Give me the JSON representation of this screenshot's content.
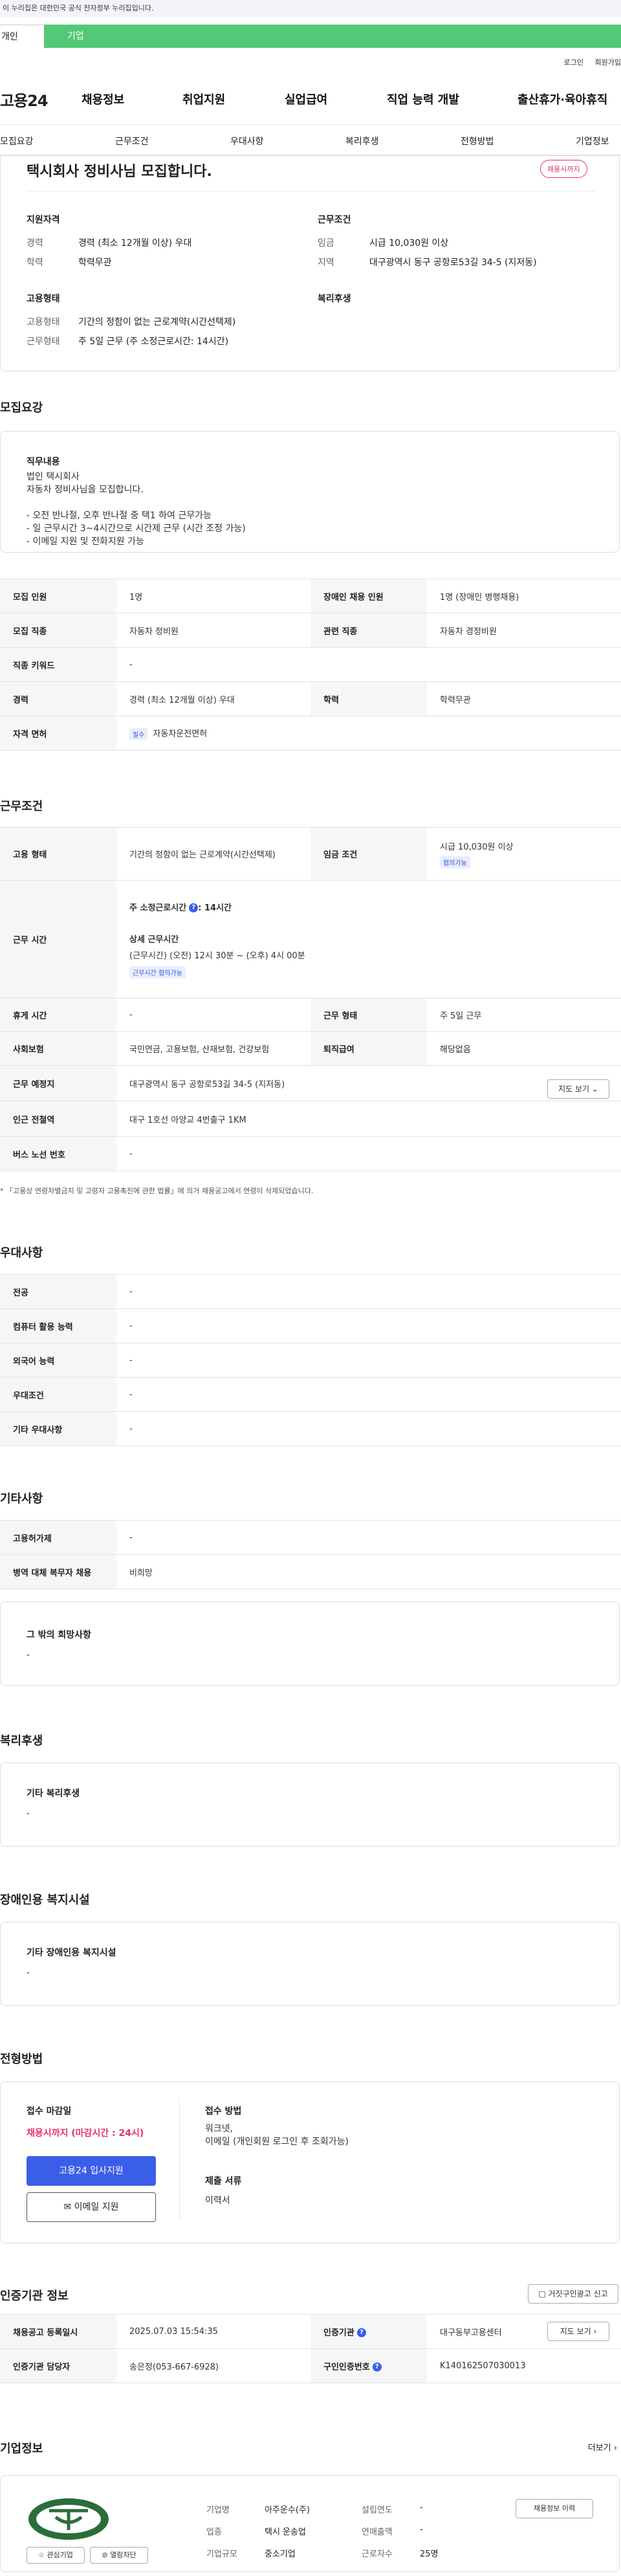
{
  "gov_banner": "이 누리집은 대한민국 공식 전자정부 누리집입니다.",
  "site_tabs": {
    "personal": "개인",
    "company": "기업"
  },
  "util_links": [
    "로그인",
    "회원가입"
  ],
  "logo": "고용24",
  "gnb": [
    "채용정보",
    "취업지원",
    "실업급여",
    "직업 능력 개발",
    "출산휴가·육아휴직"
  ],
  "subnav": [
    "모집요강",
    "근무조건",
    "우대사항",
    "복리후생",
    "전형방법",
    "기업정보"
  ],
  "summary": {
    "title": "택시회사 정비사님 모집합니다.",
    "status_badge": "채용시까지",
    "qual_heading": "지원자격",
    "cond_heading": "근무조건",
    "type_heading": "고용형태",
    "welfare_heading": "복리후생",
    "career_label": "경력",
    "career_value": "경력 (최소 12개월 이상) 우대",
    "edu_label": "학력",
    "edu_value": "학력무관",
    "wage_label": "임금",
    "wage_value": "시급 10,030원 이상",
    "region_label": "지역",
    "region_value": "대구광역시 동구 공항로53길 34-5 (지저동)",
    "emp_type_label": "고용형태",
    "emp_type_value": "기간의 정함이 없는 근로계약(시간선택제)",
    "work_type_label": "근무형태",
    "work_type_value": "주 5일 근무 (주 소정근로시간: 14시간)"
  },
  "recruit": {
    "section_title": "모집요강",
    "duty_title": "직무내용",
    "duty_text": "법인 택시회사\n자동차 정비사님을 모집합니다.\n\n- 오전 반나절, 오후 반나절 중 택1 하여 근무가능\n- 일 근무시간 3~4시간으로 시간제 근무 (시간 조정 가능)\n- 이메일 지원 및 전화지원 가능",
    "headcount_label": "모집 인원",
    "headcount_value": "1명",
    "disabled_label": "장애인 채용 인원",
    "disabled_value": "1명 (장애인 병행채용)",
    "job_label": "모집 직종",
    "job_value": "자동차 정비원",
    "related_label": "관련 직종",
    "related_value": "자동차 경정비원",
    "keyword_label": "직종 키워드",
    "keyword_value": "-",
    "career_label": "경력",
    "career_value": "경력 (최소 12개월 이상) 우대",
    "edu_label": "학력",
    "edu_value": "학력무관",
    "license_label": "자격 면허",
    "license_tag": "필수",
    "license_value": "자동차운전면허"
  },
  "conditions": {
    "section_title": "근무조건",
    "emp_type_label": "고용 형태",
    "emp_type_value": "기간의 정함이 없는 근로계약(시간선택제)",
    "wage_label": "임금 조건",
    "wage_value": "시급 10,030원 이상",
    "wage_tag": "협의가능",
    "hours_label": "근무 시간",
    "weekly_hours_title": "주 소정근로시간",
    "weekly_hours_value": ": 14시간",
    "detail_hours_title": "상세 근무시간",
    "detail_hours_value": "(근무시간) (오전) 12시 30분 ~ (오후) 4시 00분",
    "hours_tag": "근무시간 협의가능",
    "holiday_label": "휴게 시간",
    "holiday_value": "-",
    "work_form_label": "근무 형태",
    "work_form_value": "주 5일 근무",
    "insurance_label": "사회보험",
    "insurance_value": "국민연금, 고용보험, 산재보험, 건강보험",
    "severance_label": "퇴직급여",
    "severance_value": "해당없음",
    "place_label": "근무 예정지",
    "place_value": "대구광역시 동구 공항로53길 34-5 (지저동)",
    "map_button": "지도 보기",
    "station_label": "인근 전철역",
    "station_value": "대구 1호선 아양교 4번출구 1KM",
    "bus_label": "버스 노선 번호",
    "bus_value": "-",
    "note": "* 「고용상 연령차별금지 및 고령자 고용촉진에 관한 법률」에 의거 채용공고에서 연령이 삭제되었습니다."
  },
  "preferences": {
    "section_title": "우대사항",
    "rows": [
      {
        "label": "전공",
        "value": "-"
      },
      {
        "label": "컴퓨터 활용 능력",
        "value": "-"
      },
      {
        "label": "외국어 능력",
        "value": "-"
      },
      {
        "label": "우대조건",
        "value": "-"
      },
      {
        "label": "기타 우대사항",
        "value": "-"
      }
    ]
  },
  "others": {
    "section_title": "기타사항",
    "rows": [
      {
        "label": "고용허가제",
        "value": "-"
      },
      {
        "label": "병역 대체 복무자 채용",
        "value": "비희망"
      }
    ],
    "etc_title": "그 밖의 희망사항",
    "etc_value": "-"
  },
  "welfare": {
    "section_title": "복리후생",
    "box_title": "기타 복리후생",
    "box_value": "-"
  },
  "disabled_facility": {
    "section_title": "장애인용 복지시설",
    "box_title": "기타 장애인용 복지시설",
    "box_value": "-"
  },
  "process": {
    "section_title": "전형방법",
    "deadline_title": "접수 마감일",
    "deadline_value": "채용시까지 (마감시간 : 24시)",
    "apply_button": "고용24 입사지원",
    "email_button": "이메일 지원",
    "method_title": "접수 방법",
    "method_value": "워크넷,\n이메일 (개인회원 로그인 후 조회가능)",
    "docs_title": "제출 서류",
    "docs_value": "이력서"
  },
  "agency": {
    "section_title": "인증기관 정보",
    "report_button": "거짓구인광고 신고",
    "registered_label": "채용공고 등록일시",
    "registered_value": "2025.07.03 15:54:35",
    "agency_label": "인증기관",
    "agency_value": "대구동부고용센터",
    "map_button": "지도 보기",
    "manager_label": "인증기관 담당자",
    "manager_value": "송은정(053-667-6928)",
    "number_label": "구인인증번호",
    "number_value": "K140162507030013"
  },
  "company": {
    "section_title": "기업정보",
    "more_link": "더보기",
    "name_label": "기업명",
    "name_value": "아주운수(주)",
    "founded_label": "설립연도",
    "founded_value": "-",
    "industry_label": "업종",
    "industry_value": "택시 운송업",
    "sales_label": "연매출액",
    "sales_value": "-",
    "size_label": "기업규모",
    "size_value": "중소기업",
    "employees_label": "근로자수",
    "employees_value": "25명",
    "history_button": "채용정보 이력",
    "favorite_button": "관심기업",
    "block_button": "열람차단"
  },
  "colors": {
    "brand_green": "#53c977",
    "primary_blue": "#3b5ee8",
    "accent_pink": "#e3336b"
  }
}
